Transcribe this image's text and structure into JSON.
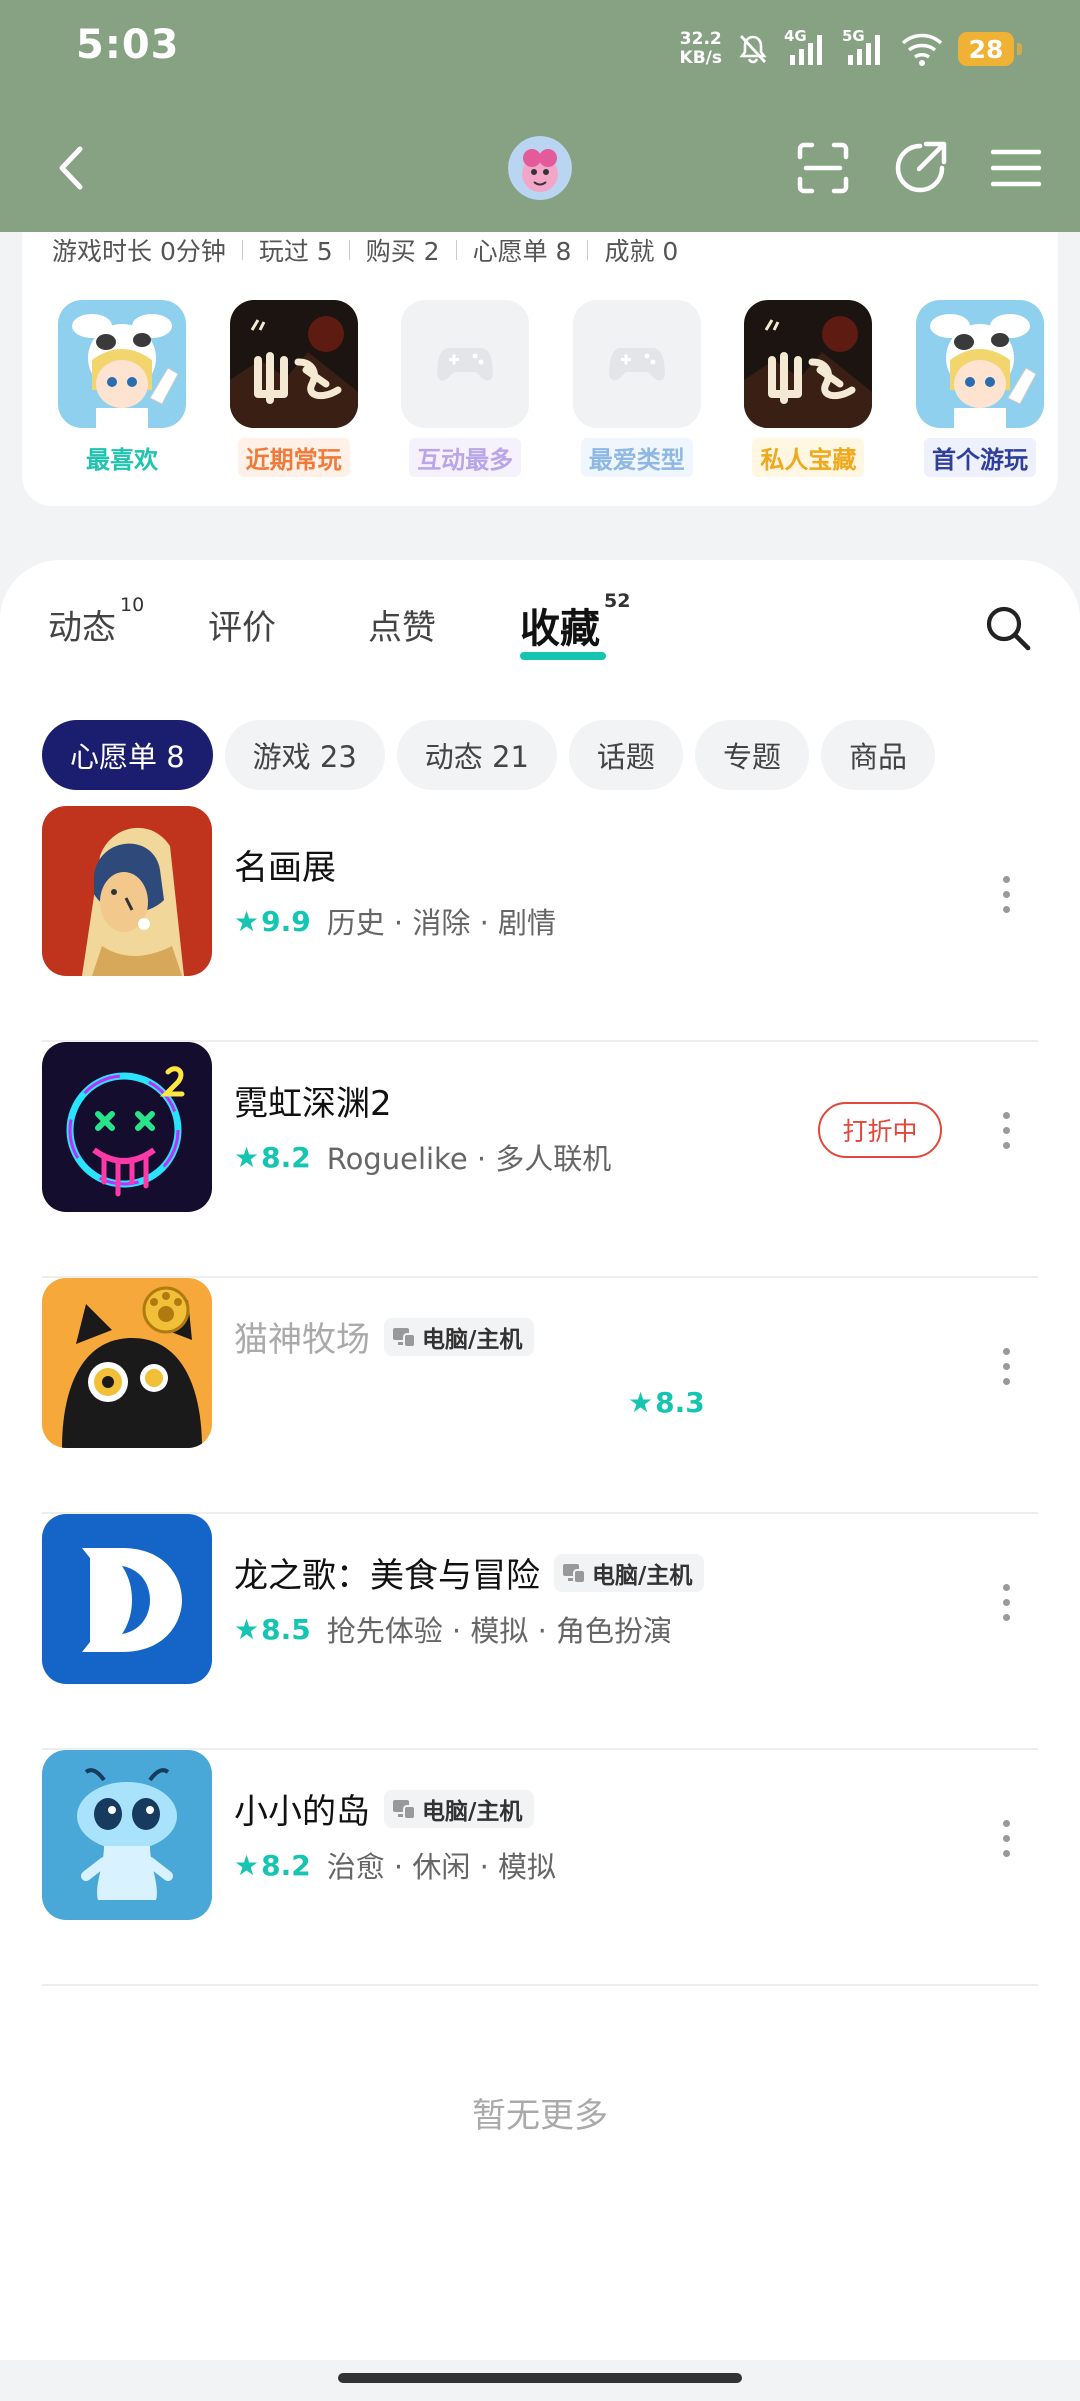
{
  "status_bar": {
    "time": "5:03",
    "net_speed_value": "32.2",
    "net_speed_unit": "KB/s",
    "net_4g": "4G",
    "net_5g": "5G",
    "battery": "28",
    "icons": [
      "mute-bell-icon",
      "signal-4g-icon",
      "signal-5g-icon",
      "wifi-icon",
      "battery-icon"
    ]
  },
  "nav": {
    "icons": [
      "back-arrow-icon",
      "avatar",
      "scan-icon",
      "share-icon",
      "menu-icon"
    ]
  },
  "profile": {
    "stats": [
      "游戏时长 0分钟",
      "玩过 5",
      "购买 2",
      "心愿单 8",
      "成就 0"
    ],
    "showcase": [
      {
        "label": "最喜欢",
        "color": "#1ec4b0",
        "bg": "#ffffff"
      },
      {
        "label": "近期常玩",
        "color": "#f07a3a",
        "bg": "#fff1e8"
      },
      {
        "label": "互动最多",
        "color": "#b7a6e8",
        "bg": "#f5f2fd"
      },
      {
        "label": "最爱类型",
        "color": "#8fb8e4",
        "bg": "#f0f6fd"
      },
      {
        "label": "私人宝藏",
        "color": "#f0a81c",
        "bg": "#fff7e2"
      },
      {
        "label": "首个游玩",
        "color": "#2f3f9c",
        "bg": "#eef0fb"
      }
    ]
  },
  "tabs": [
    {
      "label": "动态",
      "count": "10"
    },
    {
      "label": "评价",
      "count": ""
    },
    {
      "label": "点赞",
      "count": ""
    },
    {
      "label": "收藏",
      "count": "52"
    }
  ],
  "active_tab": "收藏",
  "chips": [
    "心愿单 8",
    "游戏 23",
    "动态 21",
    "话题",
    "专题",
    "商品"
  ],
  "active_chip": "心愿单 8",
  "games": [
    {
      "name": "名画展",
      "rating": "9.9",
      "tags": "历史 · 消除 · 剧情",
      "platform": "",
      "sale": ""
    },
    {
      "name": "霓虹深渊2",
      "rating": "8.2",
      "tags": "Roguelike · 多人联机",
      "platform": "",
      "sale": "打折中"
    },
    {
      "name": "猫神牧场",
      "rating": "8.3",
      "tags": "",
      "platform": "电脑/主机",
      "sale": ""
    },
    {
      "name": "龙之歌：美食与冒险",
      "rating": "8.5",
      "tags": "抢先体验 · 模拟 · 角色扮演",
      "platform": "电脑/主机",
      "sale": ""
    },
    {
      "name": "小小的岛",
      "rating": "8.2",
      "tags": "治愈 · 休闲 · 模拟",
      "platform": "电脑/主机",
      "sale": ""
    }
  ],
  "footer_text": "暂无更多",
  "colors": {
    "header_bg": "#87a283",
    "accent": "#15c5b1",
    "active_chip": "#1b1e6e",
    "sale": "#e2473b"
  }
}
